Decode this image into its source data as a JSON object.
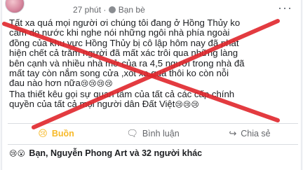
{
  "post": {
    "time": "27 phút",
    "separator": "·",
    "audience": "Bạn bè",
    "more_label": "···",
    "lines": [
      "Tất xa quá mọi người ơi chúng tôi đang ở Hồng Thủy ko",
      "cấm do nước khi nghe nói những ngôi nhà phía ngoài",
      "đồng của khu vực Hồng Thủy bị cô lập hôm nay đã phát",
      "hiện chết cả trăm người đã mất xác trôi qua những làng",
      "bên cạnh và nhiều nhà mở của ra 4,5 người trong nhà đã",
      "mất tay còn nắm song cửa ,xót xa quá thôi ko còn nỗi",
      "đau nào hơn nữa",
      "Tha thiết kêu gọi sự quan tâm của tất cả các cấp chính",
      "quyền của tất cả mọi người dân Đất Việt"
    ],
    "line7_emoji": "😢😢😢😢",
    "line9_emoji": "😢😢😢"
  },
  "actions": {
    "reaction_label": "Buồn",
    "reaction_icon": "😢",
    "comment_label": "Bình luận",
    "comment_icon": "🗨",
    "share_label": "Chia sẻ",
    "share_icon": "↪"
  },
  "summary": {
    "icons": "😢😮",
    "text": "Bạn, Nguyễn Phong Art và 32 người khác"
  },
  "colors": {
    "x_mark": "#e0262b",
    "reaction_active": "#f7b928"
  }
}
